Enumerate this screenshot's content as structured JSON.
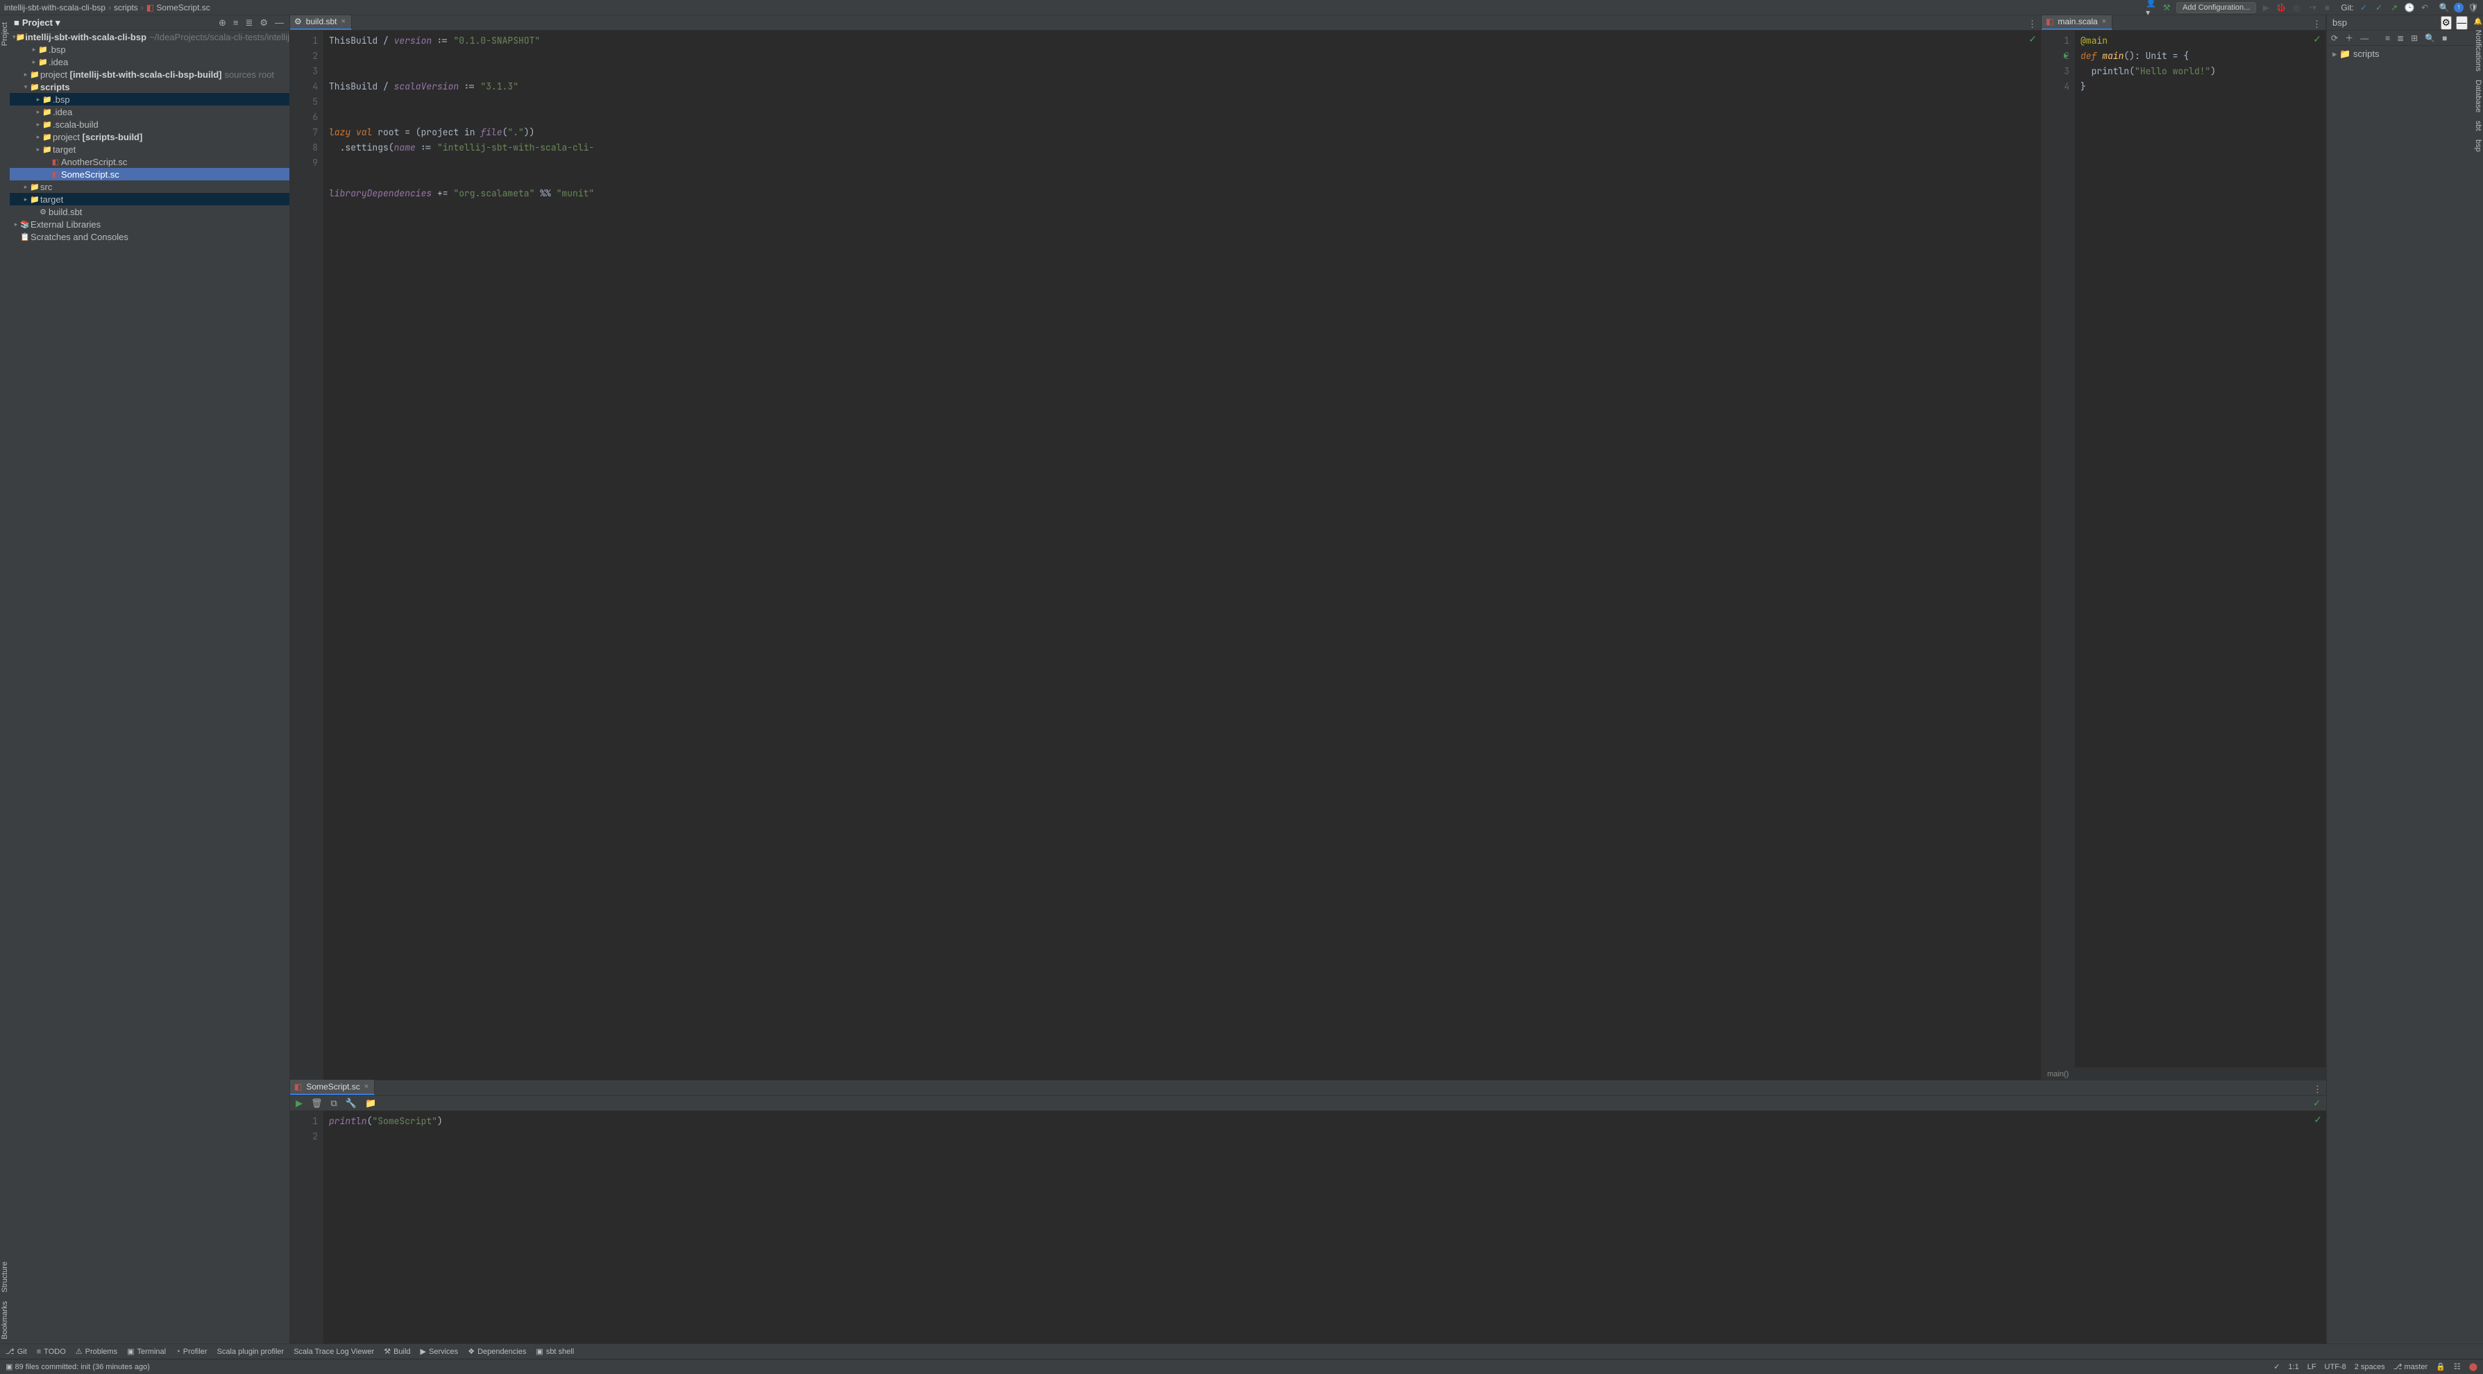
{
  "breadcrumb": {
    "seg1": "intellij-sbt-with-scala-cli-bsp",
    "seg2": "scripts",
    "seg3": "SomeScript.sc"
  },
  "top": {
    "add_config": "Add Configuration...",
    "git_label": "Git:"
  },
  "project_panel": {
    "title": "Project",
    "root_name": "intellij-sbt-with-scala-cli-bsp",
    "root_hint": "~/IdeaProjects/scala-cli-tests/intellij-s",
    "bsp1": ".bsp",
    "idea1": ".idea",
    "project1": "project",
    "project1_bold": "[intellij-sbt-with-scala-cli-bsp-build]",
    "project1_hint": "sources root",
    "scripts": "scripts",
    "scripts_bsp": ".bsp",
    "scripts_idea": ".idea",
    "scripts_scala_build": ".scala-build",
    "scripts_project": "project",
    "scripts_project_bold": "[scripts-build]",
    "scripts_target": "target",
    "another": "AnotherScript.sc",
    "some": "SomeScript.sc",
    "src": "src",
    "target2": "target",
    "build_sbt": "build.sbt",
    "external_libs": "External Libraries",
    "scratches": "Scratches and Consoles"
  },
  "editor1": {
    "tab": "build.sbt",
    "l": [
      "1",
      "2",
      "3",
      "4",
      "5",
      "6",
      "7",
      "8",
      "9"
    ],
    "c1a": "ThisBuild / ",
    "c1b": "version",
    "c1c": " := ",
    "c1d": "\"0.1.0-SNAPSHOT\"",
    "c3a": "ThisBuild / ",
    "c3b": "scalaVersion",
    "c3c": " := ",
    "c3d": "\"3.1.3\"",
    "c5a": "lazy val",
    "c5b": " root = (project in ",
    "c5c": "file",
    "c5d": "(",
    "c5e": "\".\"",
    "c5f": "))",
    "c6a": "  .settings(",
    "c6b": "name",
    "c6c": " := ",
    "c6d": "\"intellij-sbt-with-scala-cli-",
    "c8a": "libraryDependencies",
    "c8b": " += ",
    "c8c": "\"org.scalameta\"",
    "c8d": " %% ",
    "c8e": "\"munit\""
  },
  "editor2": {
    "tab": "main.scala",
    "l": [
      "1",
      "2",
      "3",
      "4"
    ],
    "c1": "@main",
    "c2a": "def ",
    "c2b": "main",
    "c2c": "(): ",
    "c2d": "Unit",
    "c2e": " = {",
    "c3a": "  println(",
    "c3b": "\"Hello world!\"",
    "c3c": ")",
    "c4": "}",
    "ctx": "main()"
  },
  "editor3": {
    "tab": "SomeScript.sc",
    "l": [
      "1",
      "2"
    ],
    "c1a": "println",
    "c1b": "(",
    "c1c": "\"SomeScript\"",
    "c1d": ")"
  },
  "bsp": {
    "title": "bsp",
    "node": "scripts"
  },
  "left_rail": {
    "project": "Project",
    "structure": "Structure",
    "bookmarks": "Bookmarks"
  },
  "right_rail": {
    "notifications": "Notifications",
    "database": "Database",
    "sbt": "sbt",
    "bsp": "bsp"
  },
  "bottom_tools": {
    "git": "Git",
    "todo": "TODO",
    "problems": "Problems",
    "terminal": "Terminal",
    "profiler": "Profiler",
    "scala_plugin": "Scala plugin profiler",
    "trace": "Scala Trace Log Viewer",
    "build": "Build",
    "services": "Services",
    "deps": "Dependencies",
    "sbtshell": "sbt shell"
  },
  "status": {
    "commit_msg": "89 files committed: init (36 minutes ago)",
    "pos": "1:1",
    "lf": "LF",
    "enc": "UTF-8",
    "indent": "2 spaces",
    "branch": "master"
  }
}
